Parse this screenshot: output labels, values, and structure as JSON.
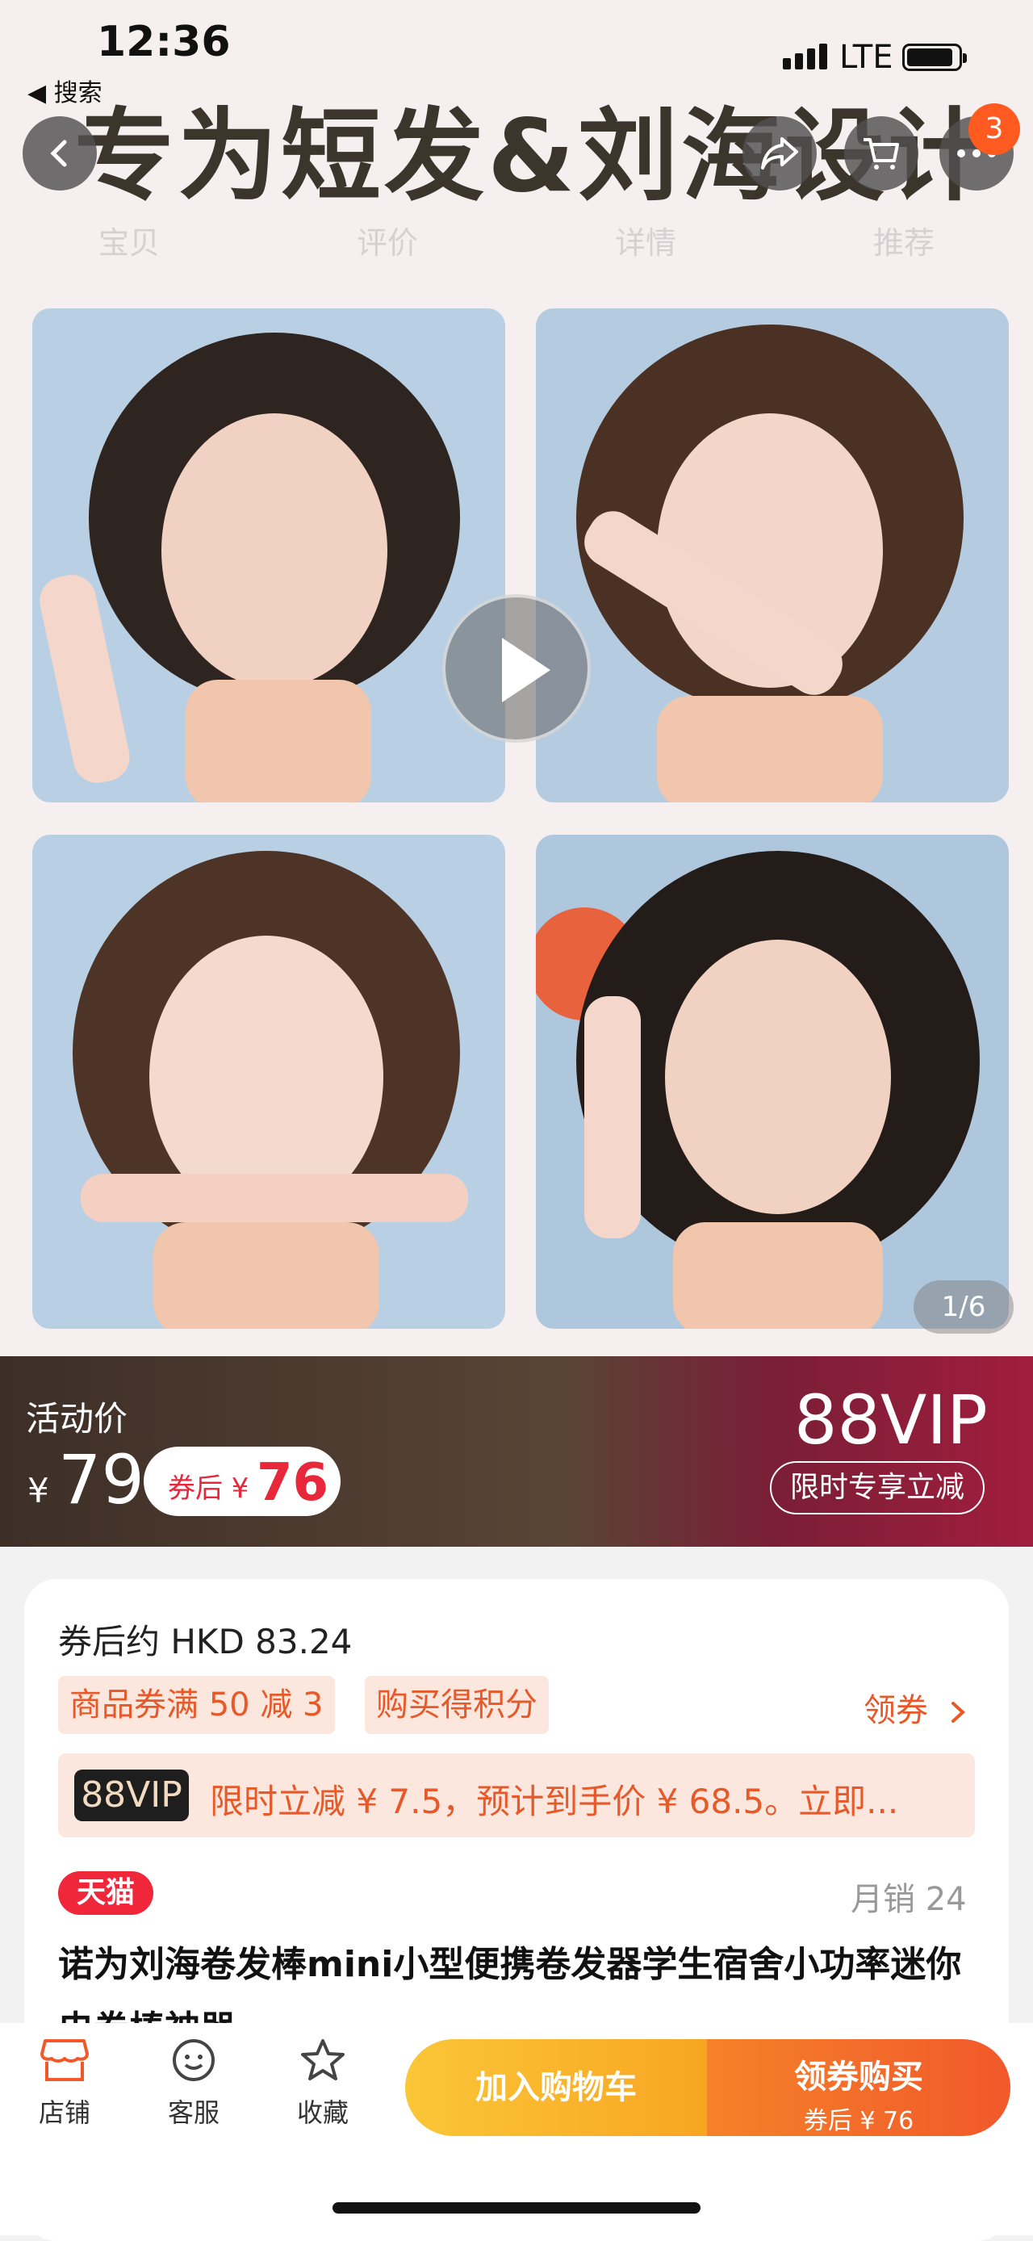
{
  "status": {
    "time": "12:36",
    "back_app": "◀ 搜索",
    "network": "LTE"
  },
  "banner": {
    "text": "专为短发&刘海设计"
  },
  "header": {
    "cart_badge": "3"
  },
  "tabs": [
    "宝贝",
    "评价",
    "详情",
    "推荐"
  ],
  "gallery": {
    "pager": "1/6"
  },
  "price": {
    "label": "活动价",
    "currency": "¥",
    "value": "79",
    "coupon_prefix": "券后 ¥",
    "coupon_value": "76",
    "vip_title": "88VIP",
    "vip_pill": "限时专享立减"
  },
  "info": {
    "after_coupon_hkd": "券后约 HKD 83.24",
    "tags": [
      "商品券满 50 减 3",
      "购买得积分"
    ],
    "get_coupon": "领券",
    "vip_logo": "88VIP",
    "vip_text": "限时立减 ¥ 7.5，预计到手价 ¥ 68.5。立即...",
    "store_badge": "天猫",
    "monthly_sales": "月销 24",
    "title": "诺为刘海卷发棒mini小型便携卷发器学生宿舍小功率迷你电卷棒神器"
  },
  "bottom": {
    "shop": "店铺",
    "service": "客服",
    "favorite": "收藏",
    "add_cart": "加入购物车",
    "buy": "领券购买",
    "buy_sub": "券后 ¥ 76"
  },
  "colors": {
    "accent": "#e8592a",
    "price_red": "#e8273a",
    "cart_yellow": "#fbc638",
    "buy_orange": "#f1582a"
  },
  "icons": [
    "chevron-left-icon",
    "share-icon",
    "cart-icon",
    "more-icon",
    "play-icon",
    "store-icon",
    "service-icon",
    "star-icon",
    "chevron-right-icon"
  ]
}
